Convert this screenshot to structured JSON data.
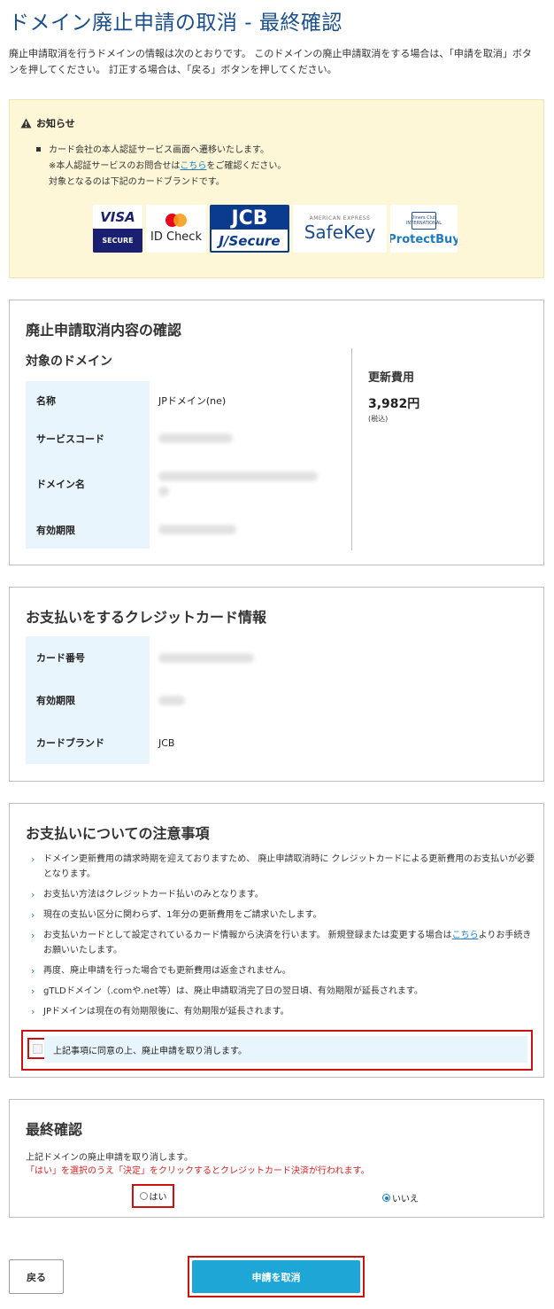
{
  "page": {
    "title": "ドメイン廃止申請の取消 - 最終確認",
    "intro": "廃止申請取消を行うドメインの情報は次のとおりです。 このドメインの廃止申請取消をする場合は、「申請を取消」ボタンを押してください。 訂正する場合は、「戻る」ボタンを押してください。"
  },
  "notice": {
    "heading": "お知らせ",
    "line1": "カード会社の本人認証サービス画面へ遷移いたします。",
    "line2_prefix": "※本人認証サービスのお問合せは",
    "line2_link": "こちら",
    "line2_suffix": "をご確認ください。",
    "line3": "対象となるのは下記のカードブランドです。",
    "brands": {
      "visa_top": "VISA",
      "visa_bottom": "SECURE",
      "mastercard": "ID Check",
      "jcb_top": "JCB",
      "jcb_bottom": "J/Secure",
      "amex_small": "AMERICAN EXPRESS",
      "amex": "SafeKey",
      "diners_logo": "Diners Club INTERNATIONAL",
      "diners": "ProtectBuy"
    }
  },
  "confirm_section": {
    "title": "廃止申請取消内容の確認",
    "domain_subtitle": "対象のドメイン",
    "rows": [
      {
        "key": "名称",
        "value": "JPドメイン(ne)"
      },
      {
        "key": "サービスコード",
        "value": ""
      },
      {
        "key": "ドメイン名",
        "value": ""
      },
      {
        "key": "有効期限",
        "value": ""
      }
    ],
    "fee_label": "更新費用",
    "fee_price": "3,982円",
    "fee_tax": "(税込)"
  },
  "card_section": {
    "title": "お支払いをするクレジットカード情報",
    "rows": [
      {
        "key": "カード番号",
        "value": ""
      },
      {
        "key": "有効期限",
        "value": ""
      },
      {
        "key": "カードブランド",
        "value": "JCB"
      }
    ]
  },
  "payment_notes": {
    "title": "お支払いについての注意事項",
    "items": [
      "ドメイン更新費用の請求時期を迎えておりますため、 廃止申請取消時に クレジットカードによる更新費用のお支払いが必要となります。",
      "お支払い方法はクレジットカード払いのみとなります。",
      "現在の支払い区分に関わらず、1年分の更新費用をご請求いたします。",
      "",
      "再度、廃止申請を行った場合でも更新費用は返金されません。",
      "gTLDドメイン（.comや.net等）は、廃止申請取消完了日の翌日頃、有効期限が延長されます。",
      "JPドメインは現在の有効期限後に、有効期限が延長されます。"
    ],
    "item4_prefix": "お支払いカードとして設定されているカード情報から決済を行います。 新規登録または変更する場合は",
    "item4_link": "こちら",
    "item4_suffix": "よりお手続きお願いいたします。",
    "agree_label": "上記事項に同意の上、廃止申請を取り消します。"
  },
  "final_section": {
    "title": "最終確認",
    "text": "上記ドメインの廃止申請を取り消します。",
    "warning": "「はい」を選択のうえ「決定」をクリックするとクレジットカード決済が行われます。",
    "yes_label": "はい",
    "no_label": "いいえ",
    "selected": "いいえ"
  },
  "buttons": {
    "back": "戻る",
    "submit": "申請を取消"
  },
  "colors": {
    "title_blue": "#1a4f8b",
    "accent_blue": "#1ea6d6",
    "highlight_red": "#cc1111",
    "notice_bg": "#fdf7d8",
    "table_key_bg": "#e8f5fd"
  }
}
